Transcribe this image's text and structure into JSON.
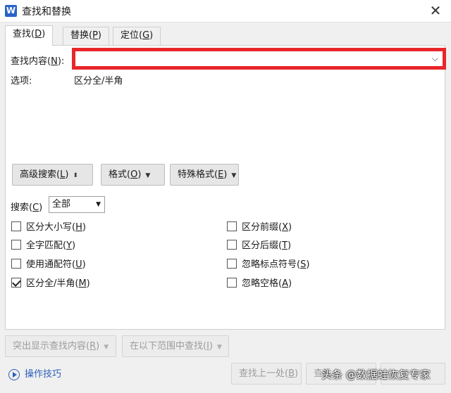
{
  "window": {
    "title": "查找和替换",
    "app_icon_letter": "W",
    "close_glyph": "✕"
  },
  "tabs": [
    {
      "label": "查找(",
      "key": "D",
      "suffix": ")"
    },
    {
      "label": "替换(",
      "key": "P",
      "suffix": ")"
    },
    {
      "label": "定位(",
      "key": "G",
      "suffix": ")"
    }
  ],
  "find": {
    "label": "查找内容(",
    "key": "N",
    "suffix": "):",
    "value": "",
    "arrow": "⌵"
  },
  "options": {
    "label": "选项:",
    "value": "区分全/半角"
  },
  "buttons": {
    "advanced": {
      "label": "高级搜索(",
      "key": "L",
      "suffix": ")",
      "icon": "⬍"
    },
    "format": {
      "label": "格式(",
      "key": "O",
      "suffix": ")",
      "icon": "▼"
    },
    "special": {
      "label": "特殊格式(",
      "key": "E",
      "suffix": ")",
      "icon": "▼"
    }
  },
  "search": {
    "label": "搜索(",
    "key": "C",
    "suffix": ")",
    "value": "全部",
    "arrow": "▼"
  },
  "checkboxes_left": [
    {
      "label": "区分大小写(",
      "key": "H",
      "suffix": ")",
      "checked": false
    },
    {
      "label": "全字匹配(",
      "key": "Y",
      "suffix": ")",
      "checked": false
    },
    {
      "label": "使用通配符(",
      "key": "U",
      "suffix": ")",
      "checked": false
    },
    {
      "label": "区分全/半角(",
      "key": "M",
      "suffix": ")",
      "checked": true
    }
  ],
  "checkboxes_right": [
    {
      "label": "区分前缀(",
      "key": "X",
      "suffix": ")",
      "checked": false
    },
    {
      "label": "区分后缀(",
      "key": "T",
      "suffix": ")",
      "checked": false
    },
    {
      "label": "忽略标点符号(",
      "key": "S",
      "suffix": ")",
      "checked": false
    },
    {
      "label": "忽略空格(",
      "key": "A",
      "suffix": ")",
      "checked": false
    }
  ],
  "bottom": {
    "highlight": {
      "label": "突出显示查找内容(",
      "key": "R",
      "suffix": ")",
      "icon": "▼"
    },
    "find_in": {
      "label": "在以下范围中查找(",
      "key": "I",
      "suffix": ")",
      "icon": "▼"
    },
    "find_prev": {
      "label": "查找上一处(",
      "key": "B",
      "suffix": ")"
    },
    "find_next_partial": "查找",
    "tips": "操作技巧",
    "watermark": "头条 @数据蛙恢复专家"
  }
}
